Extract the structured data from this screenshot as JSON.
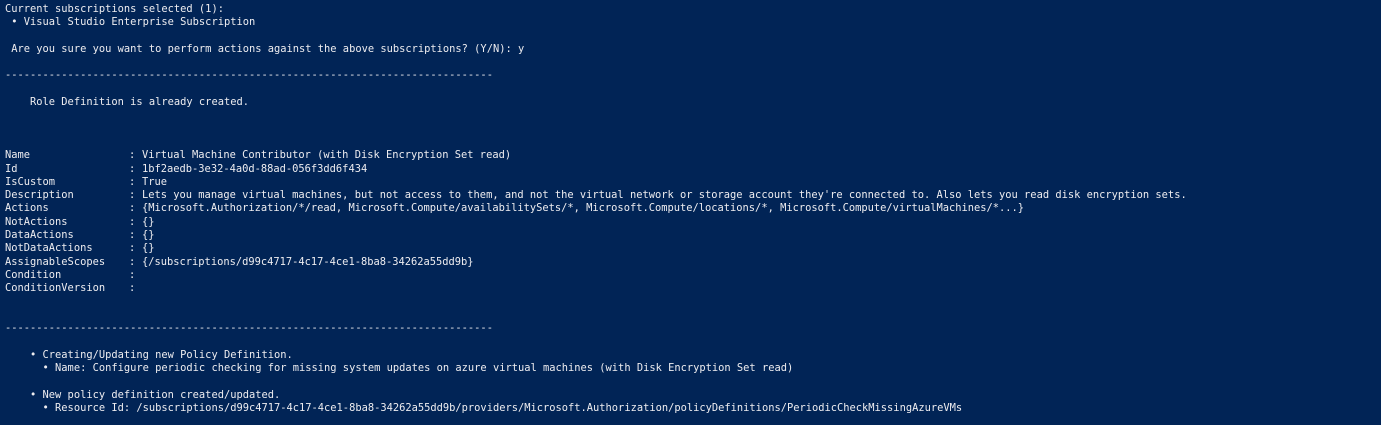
{
  "terminal": {
    "subscriptions_header": "Current subscriptions selected (1):",
    "subscription_item": " • Visual Studio Enterprise Subscription",
    "confirm_prompt": " Are you sure you want to perform actions against the above subscriptions? (Y/N): y",
    "separator": "------------------------------------------------------------------------------",
    "role_status": "    Role Definition is already created.",
    "properties": [
      {
        "key": "Name",
        "value": "Virtual Machine Contributor (with Disk Encryption Set read)"
      },
      {
        "key": "Id",
        "value": "1bf2aedb-3e32-4a0d-88ad-056f3dd6f434"
      },
      {
        "key": "IsCustom",
        "value": "True"
      },
      {
        "key": "Description",
        "value": "Lets you manage virtual machines, but not access to them, and not the virtual network or storage account they're connected to. Also lets you read disk encryption sets."
      },
      {
        "key": "Actions",
        "value": "{Microsoft.Authorization/*/read, Microsoft.Compute/availabilitySets/*, Microsoft.Compute/locations/*, Microsoft.Compute/virtualMachines/*...}"
      },
      {
        "key": "NotActions",
        "value": "{}"
      },
      {
        "key": "DataActions",
        "value": "{}"
      },
      {
        "key": "NotDataActions",
        "value": "{}"
      },
      {
        "key": "AssignableScopes",
        "value": "{/subscriptions/d99c4717-4c17-4ce1-8ba8-34262a55dd9b}"
      },
      {
        "key": "Condition",
        "value": ""
      },
      {
        "key": "ConditionVersion",
        "value": ""
      }
    ],
    "policy_creating": "    • Creating/Updating new Policy Definition.",
    "policy_name": "      • Name: Configure periodic checking for missing system updates on azure virtual machines (with Disk Encryption Set read)",
    "policy_created": "    • New policy definition created/updated.",
    "policy_resource_id": "      • Resource Id: /subscriptions/d99c4717-4c17-4ce1-8ba8-34262a55dd9b/providers/Microsoft.Authorization/policyDefinitions/PeriodicCheckMissingAzureVMs"
  }
}
